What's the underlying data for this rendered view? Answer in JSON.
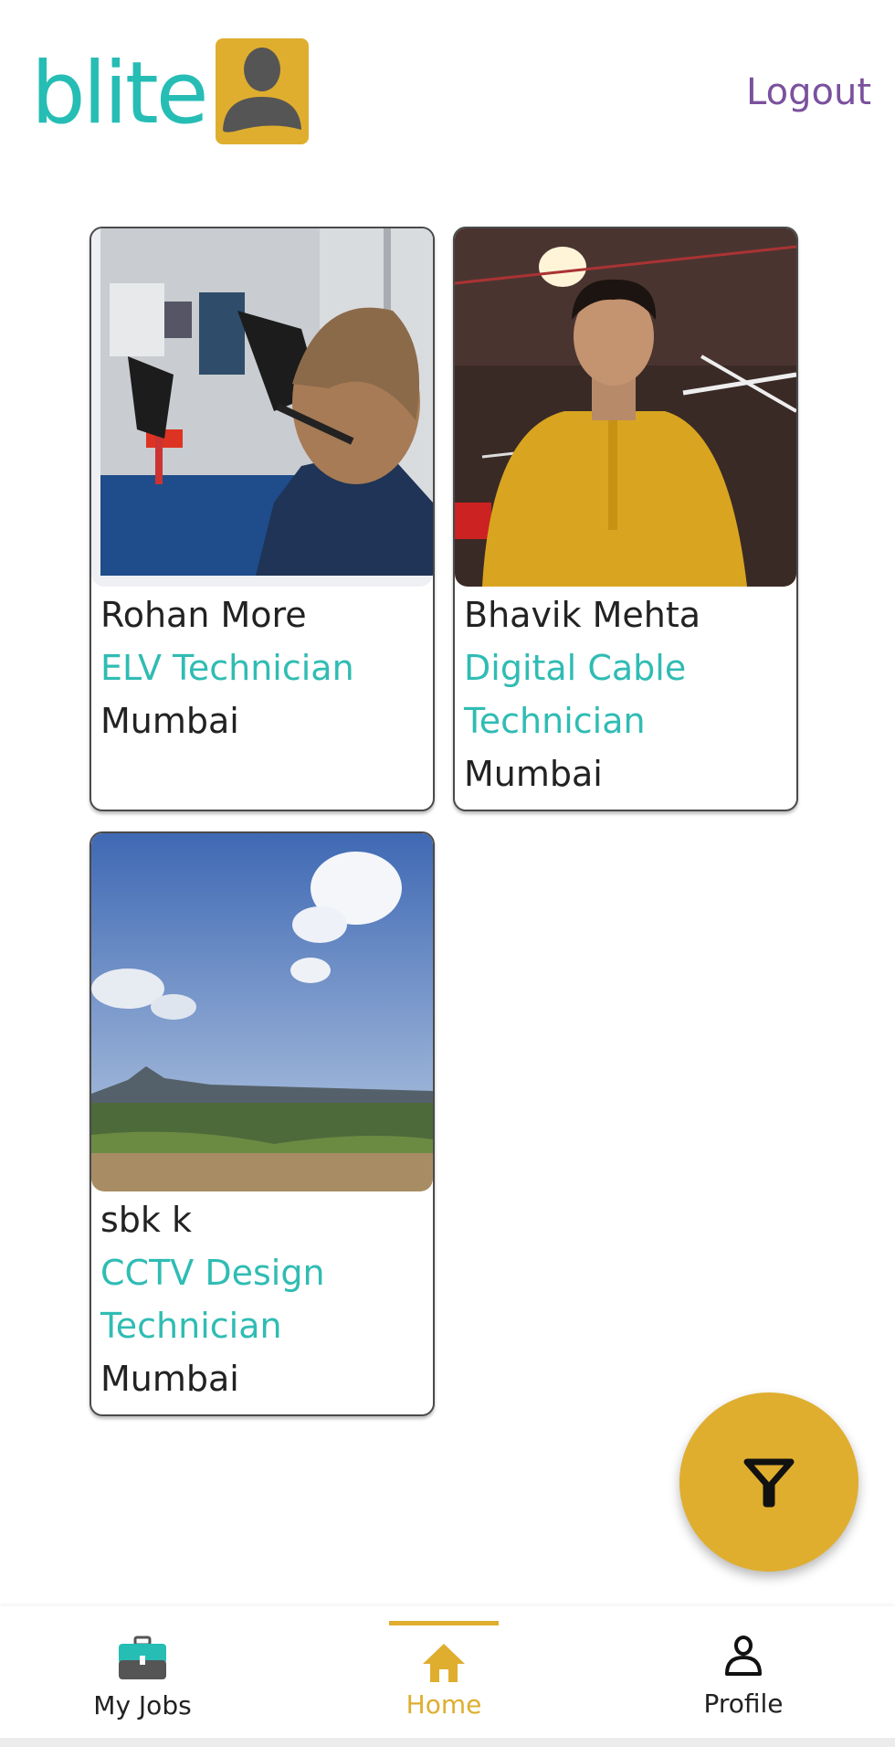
{
  "header": {
    "logo_text": "blite",
    "logout_label": "Logout"
  },
  "technicians": [
    {
      "name": "Rohan More",
      "role": "ELV Technician",
      "city": "Mumbai",
      "photo": "electrician-at-panel-photo"
    },
    {
      "name": "Bhavik Mehta",
      "role": "Digital Cable Technician",
      "city": "Mumbai",
      "photo": "man-in-yellow-kurta-photo"
    },
    {
      "name": "sbk k",
      "role": "CCTV Design Technician",
      "city": "Mumbai",
      "photo": "landscape-sky-photo"
    }
  ],
  "fab": {
    "icon": "filter-icon"
  },
  "bottom_nav": {
    "items": [
      {
        "label": "My Jobs",
        "icon": "briefcase-icon",
        "active": false
      },
      {
        "label": "Home",
        "icon": "home-icon",
        "active": true
      },
      {
        "label": "Profile",
        "icon": "person-icon",
        "active": false
      }
    ]
  },
  "colors": {
    "brand_teal": "#26bdb5",
    "accent_gold": "#dfae2f",
    "logout_purple": "#7b519d",
    "role_teal": "#2fbcb3"
  }
}
